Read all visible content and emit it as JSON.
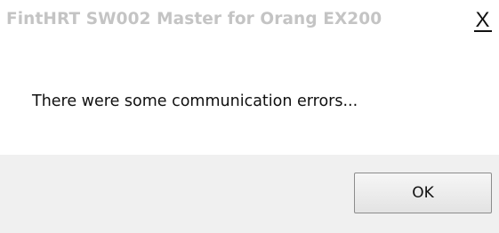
{
  "window": {
    "title": "FintHRT SW002 Master for Orang EX200",
    "close_glyph": "X"
  },
  "message": "There were some communication errors...",
  "buttons": {
    "ok_label": "OK"
  },
  "icons": [
    "close-icon"
  ],
  "colors": {
    "title_text": "#c4c4c4",
    "footer_background": "#f0f0f0",
    "button_border": "#8c8c8c"
  }
}
